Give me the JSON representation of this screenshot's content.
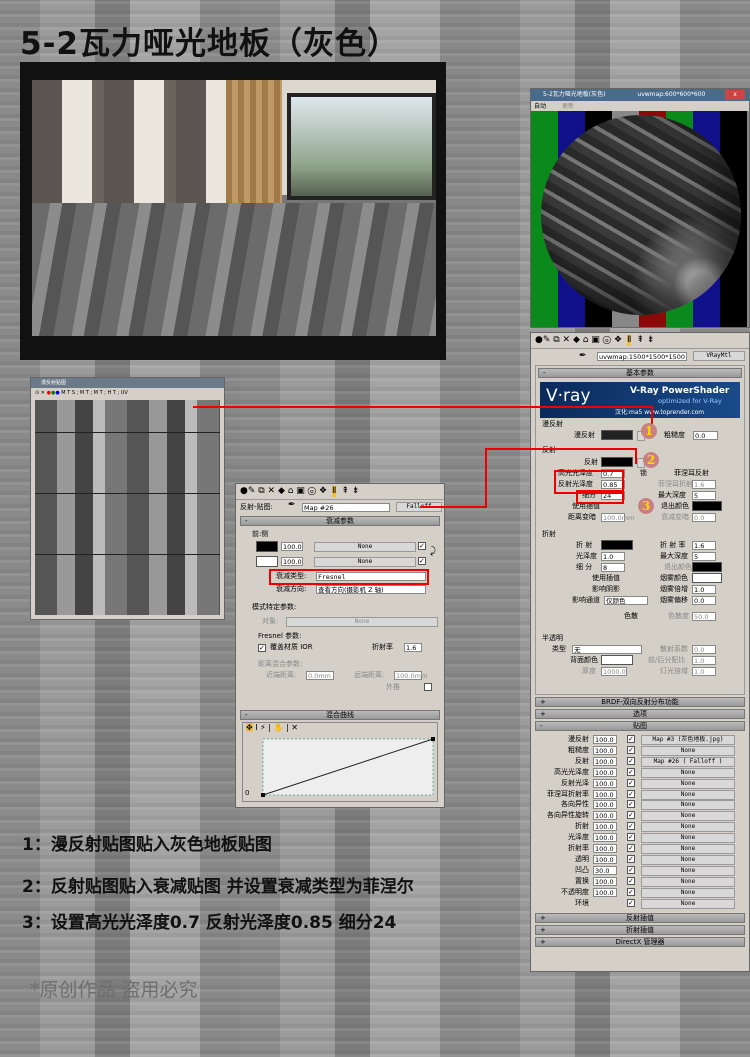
{
  "title": "5-2瓦力哑光地板（灰色）",
  "preview": {
    "title": "5-2瓦力哑光地板(灰色)",
    "map": "uvwmap:600*600*600",
    "auto": "自动",
    "update": "更新",
    "close": "x"
  },
  "bitmap": {
    "title": "漫反射贴图",
    "toolbar": "M T S ; M T ; M T ; H T ; UV"
  },
  "falloff": {
    "slot_label": "反射-贴图:",
    "map_name": "Map #26",
    "type_button": "Falloff",
    "rollout": "衰减参数",
    "front_side": "前:侧",
    "amount1": "100.0",
    "amount2": "100.0",
    "none1": "None",
    "none2": "None",
    "falloff_type_label": "衰减类型:",
    "falloff_type": "Fresnel",
    "falloff_dir_label": "衰减方向:",
    "falloff_dir": "查看方向(摄影机 Z 轴)",
    "mode_params": "模式特定参数:",
    "object_label": "对象:",
    "object_none": "None",
    "fresnel_params": "Fresnel 参数:",
    "override_ior": "覆盖材质 IOR",
    "ior_label": "折射率",
    "ior": "1.6",
    "dist_params": "距离混合参数:",
    "near_label": "近端距离:",
    "near": "0.0mm",
    "far_label": "远端距离:",
    "far": "100.0mm",
    "extrap": "外推",
    "curve_rollout": "混合曲线",
    "curve_zero": "0"
  },
  "material": {
    "map_select": "uvwmap:1500*1500*1500",
    "type_button": "VRayMtl",
    "basic_rollout": "基本参数",
    "vray_logo": "V·ray",
    "vray_title": "V-Ray PowerShader",
    "vray_sub": "optimized for V-Ray",
    "vray_credit": "汉化:ma5 www.toprender.com",
    "diffuse_group": "漫反射",
    "diffuse_label": "漫反射",
    "roughness_label": "粗糙度",
    "roughness": "0.0",
    "reflect_group": "反射",
    "reflect_label": "反射",
    "hilight_label": "高光光泽度",
    "hilight": "0.7",
    "refl_gloss_label": "反射光泽度",
    "refl_gloss": "0.85",
    "subdiv_label": "细分",
    "subdiv": "24",
    "lock": "锁",
    "fresnel_label": "菲涅耳反射",
    "fresnel_ior_label": "菲涅耳折射率",
    "fresnel_ior": "1.6",
    "max_depth_label": "最大深度",
    "max_depth": "5",
    "use_interp": "使用插值",
    "exit_color": "退出颜色",
    "dim_dist": "距离变暗",
    "dim_dist_val": "100.0mm",
    "dim_falloff": "衰减变暗",
    "dim_falloff_val": "0.0",
    "refract_group": "折射",
    "refract_label": "折 射",
    "refract_ior_label": "折 射 率",
    "refract_ior": "1.6",
    "gloss_label": "光泽度",
    "gloss": "1.0",
    "rmax_depth": "5",
    "rsubdiv_label": "细 分",
    "rsubdiv": "8",
    "exit_color2": "退出颜色",
    "r_interp": "使用插值",
    "fog_color": "烟雾颜色",
    "affect_shadows": "影响阴影",
    "fog_mult_label": "烟雾倍增",
    "fog_mult": "1.0",
    "affect_channels": "影响通道",
    "channels": "仅颜色",
    "fog_bias_label": "烟雾偏移",
    "fog_bias": "0.0",
    "dispersion": "色散",
    "abbe_label": "色散度",
    "abbe": "50.0",
    "translucent_group": "半透明",
    "type_label": "类型",
    "type_value": "无",
    "scatter_label": "散射系数",
    "scatter": "0.0",
    "back_color": "背面颜色",
    "fb_label": "前/后分配比",
    "fb": "1.0",
    "thickness_label": "厚度",
    "thickness": "1000.0",
    "light_mult_label": "灯光倍增",
    "light_mult": "1.0",
    "brdf_rollout": "BRDF-双向反射分布功能",
    "options_rollout": "选项",
    "maps_rollout": "贴图",
    "maps": [
      {
        "name": "漫反射",
        "amt": "100.0",
        "map": "Map #3 (灰色地板.jpg)"
      },
      {
        "name": "粗糙度",
        "amt": "100.0",
        "map": "None"
      },
      {
        "name": "反射",
        "amt": "100.0",
        "map": "Map #26 ( Falloff )"
      },
      {
        "name": "高光光泽度",
        "amt": "100.0",
        "map": "None"
      },
      {
        "name": "反射光泽",
        "amt": "100.0",
        "map": "None"
      },
      {
        "name": "菲涅耳折射率",
        "amt": "100.0",
        "map": "None"
      },
      {
        "name": "各向异性",
        "amt": "100.0",
        "map": "None"
      },
      {
        "name": "各向异性旋转",
        "amt": "100.0",
        "map": "None"
      },
      {
        "name": "折射",
        "amt": "100.0",
        "map": "None"
      },
      {
        "name": "光泽度",
        "amt": "100.0",
        "map": "None"
      },
      {
        "name": "折射率",
        "amt": "100.0",
        "map": "None"
      },
      {
        "name": "透明",
        "amt": "100.0",
        "map": "None"
      },
      {
        "name": "凹凸",
        "amt": "30.0",
        "map": "None"
      },
      {
        "name": "置换",
        "amt": "100.0",
        "map": "None"
      },
      {
        "name": "不透明度",
        "amt": "100.0",
        "map": "None"
      },
      {
        "name": "环境",
        "amt": "",
        "map": "None"
      }
    ],
    "reflect_interp": "反射插值",
    "refract_interp": "折射插值",
    "directx": "DirectX 管理器"
  },
  "badges": [
    "1",
    "2",
    "3"
  ],
  "notes": [
    "1：漫反射贴图贴入灰色地板贴图",
    "2：反射贴图贴入衰减贴图 并设置衰减类型为菲涅尔",
    "3：设置高光光泽度0.7 反射光泽度0.85 细分24"
  ],
  "watermark": "*原创作品 盗用必究"
}
